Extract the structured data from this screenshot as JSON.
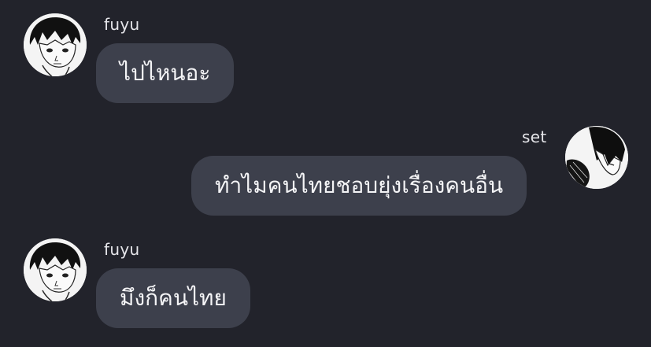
{
  "messages": [
    {
      "sender": "fuyu",
      "side": "left",
      "text": "ไปไหนอะ",
      "avatar": "fuyu-avatar"
    },
    {
      "sender": "set",
      "side": "right",
      "text": "ทำไมคนไทยชอบยุ่งเรื่องคนอื่น",
      "avatar": "set-avatar"
    },
    {
      "sender": "fuyu",
      "side": "left",
      "text": "มึงก็คนไทย",
      "avatar": "fuyu-avatar"
    }
  ],
  "colors": {
    "background": "#22232b",
    "bubble": "#3d404c",
    "text": "#f4f4f6",
    "sender_label": "#e6e6ea"
  }
}
